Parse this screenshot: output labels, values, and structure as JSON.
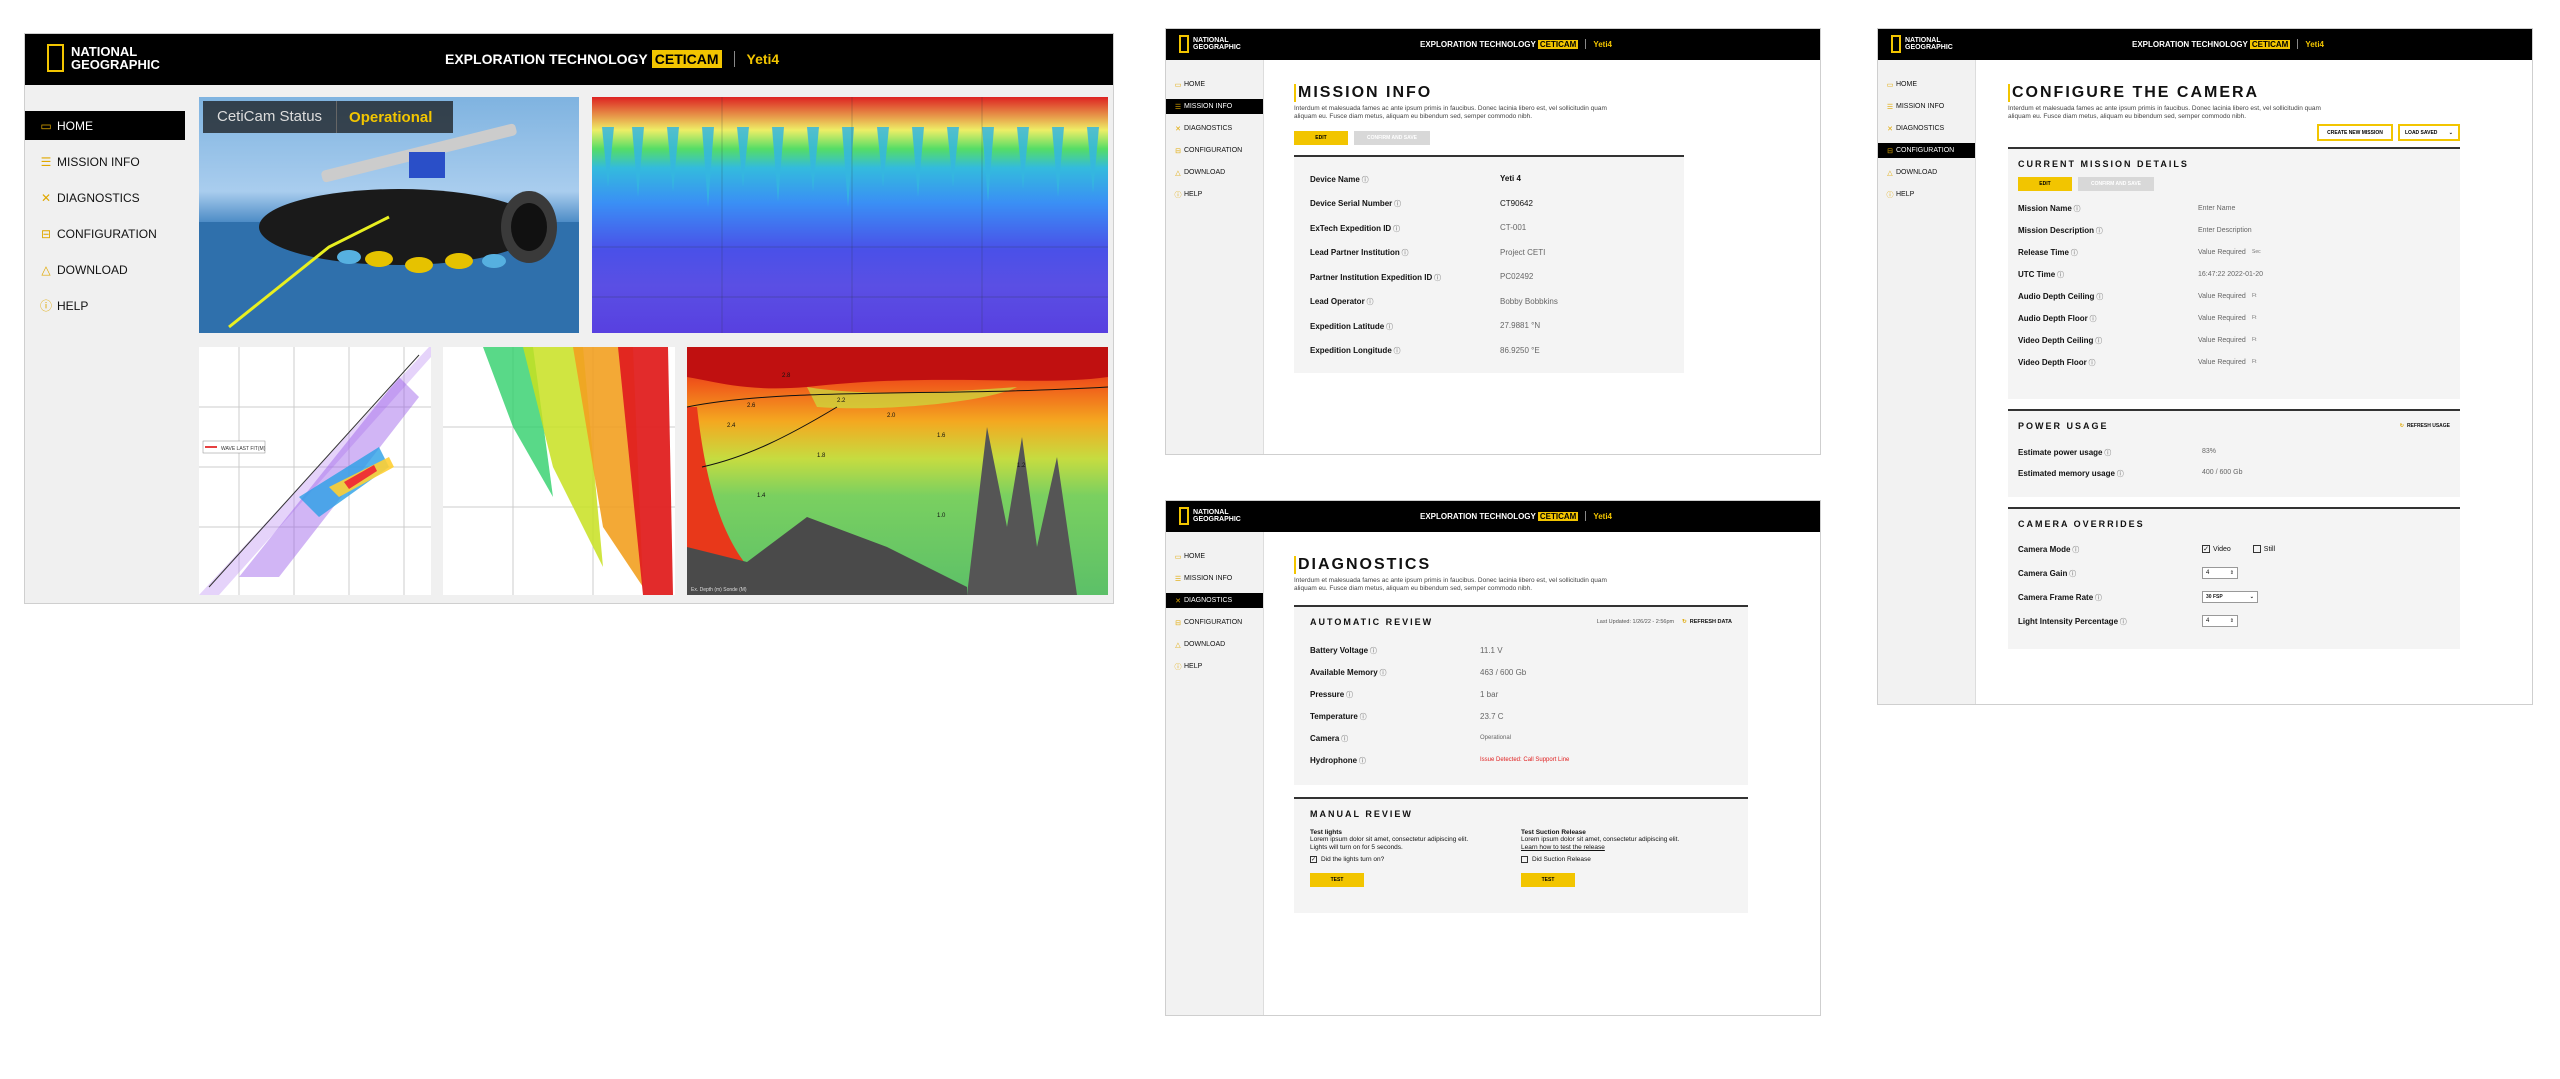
{
  "brand": {
    "logo_line1": "NATIONAL",
    "logo_line2": "GEOGRAPHIC",
    "header_prefix": "EXPLORATION TECHNOLOGY",
    "header_highlight": "CETICAM",
    "header_device": "Yeti4"
  },
  "nav_items": [
    {
      "label": "HOME",
      "icon": "camera-icon"
    },
    {
      "label": "MISSION INFO",
      "icon": "list-icon"
    },
    {
      "label": "DIAGNOSTICS",
      "icon": "wrench-icon"
    },
    {
      "label": "CONFIGURATION",
      "icon": "sliders-icon"
    },
    {
      "label": "DOWNLOAD",
      "icon": "download-icon"
    },
    {
      "label": "HELP",
      "icon": "help-icon"
    }
  ],
  "home": {
    "status_label": "CetiCam Status",
    "status_value": "Operational",
    "scatter_legend": "WAVE LAST FIT(M)",
    "contour_labels": [
      "2.8",
      "2.6",
      "2.4",
      "2.2",
      "2.0",
      "1.8",
      "1.6",
      "1.4",
      "1.2",
      "1.0"
    ],
    "contour_footer": "Ex. Depth (m) Sonde (M)"
  },
  "lorem": "Interdum et malesuada fames ac ante ipsum primis in faucibus. Donec lacinia libero est, vel sollicitudin quam aliquam eu. Fusce diam metus, aliquam eu bibendum sed, semper commodo nibh.",
  "mission": {
    "title": "MISSION INFO",
    "edit": "EDIT",
    "confirm": "CONFIRM AND SAVE",
    "rows": [
      {
        "k": "Device Name",
        "v": "Yeti 4",
        "dark": true
      },
      {
        "k": "Device Serial Number",
        "v": "CT90642",
        "dark": true
      },
      {
        "k": "ExTech Expedition ID",
        "v": "CT-001"
      },
      {
        "k": "Lead Partner Institution",
        "v": "Project CETI"
      },
      {
        "k": "Partner Institution Expedition ID",
        "v": "PC02492"
      },
      {
        "k": "Lead Operator",
        "v": "Bobby Bobbkins"
      },
      {
        "k": "Expedition Latitude",
        "v": "27.9881 °N"
      },
      {
        "k": "Expedition Longitude",
        "v": "86.9250 °E"
      }
    ]
  },
  "diag": {
    "title": "DIAGNOSTICS",
    "auto_title": "AUTOMATIC REVIEW",
    "last_updated": "Last Updated: 1/26/22 - 2:56pm",
    "refresh": "REFRESH DATA",
    "rows": [
      {
        "k": "Battery Voltage",
        "v": "11.1 V"
      },
      {
        "k": "Available Memory",
        "v": "463 / 600 Gb"
      },
      {
        "k": "Pressure",
        "v": "1 bar"
      },
      {
        "k": "Temperature",
        "v": "23.7 C"
      },
      {
        "k": "Camera",
        "v": "Operational"
      },
      {
        "k": "Hydrophone",
        "v": "Issue Detected: Call Support Line"
      }
    ],
    "manual_title": "MANUAL REVIEW",
    "test1": {
      "title": "Test lights",
      "text": "Lorem ipsum dolor sit amet, consectetur adipiscing elit. Lights will turn on for 5 seconds.",
      "check": "Did the lights turn on?",
      "button": "TEST"
    },
    "test2": {
      "title": "Test Suction Release",
      "text": "Lorem ipsum dolor sit amet, consectetur adipiscing elit.",
      "link": "Learn how to test the release",
      "check": "Did Suction Release",
      "button": "TEST"
    }
  },
  "config": {
    "title": "CONFIGURE THE CAMERA",
    "create": "CREATE NEW MISSION",
    "load": "LOAD SAVED",
    "cmd_title": "CURRENT MISSION DETAILS",
    "edit": "EDIT",
    "confirm": "CONFIRM AND SAVE",
    "rows": [
      {
        "k": "Mission Name",
        "v": "Enter Name",
        "u": ""
      },
      {
        "k": "Mission Description",
        "v": "Enter Description",
        "u": ""
      },
      {
        "k": "Release Time",
        "v": "Value Required",
        "u": "Sec"
      },
      {
        "k": "UTC Time",
        "v": "16:47:22 2022-01-20",
        "u": ""
      },
      {
        "k": "Audio Depth Ceiling",
        "v": "Value Required",
        "u": "Ft"
      },
      {
        "k": "Audio Depth Floor",
        "v": "Value Required",
        "u": "Ft"
      },
      {
        "k": "Video Depth Ceiling",
        "v": "Value Required",
        "u": "Ft"
      },
      {
        "k": "Video Depth Floor",
        "v": "Value Required",
        "u": "Ft"
      }
    ],
    "power_title": "POWER USAGE",
    "refresh": "REFRESH USAGE",
    "power_rows": [
      {
        "k": "Estimate power usage",
        "v": "83%"
      },
      {
        "k": "Estimated memory usage",
        "v": "400 / 600 Gb"
      }
    ],
    "over_title": "CAMERA OVERRIDES",
    "mode_label": "Camera Mode",
    "mode_video": "Video",
    "mode_still": "Still",
    "gain_label": "Camera Gain",
    "gain_value": "4",
    "fps_label": "Camera Frame Rate",
    "fps_value": "30 FSP",
    "light_label": "Light Intensity Percentage",
    "light_value": "4"
  }
}
